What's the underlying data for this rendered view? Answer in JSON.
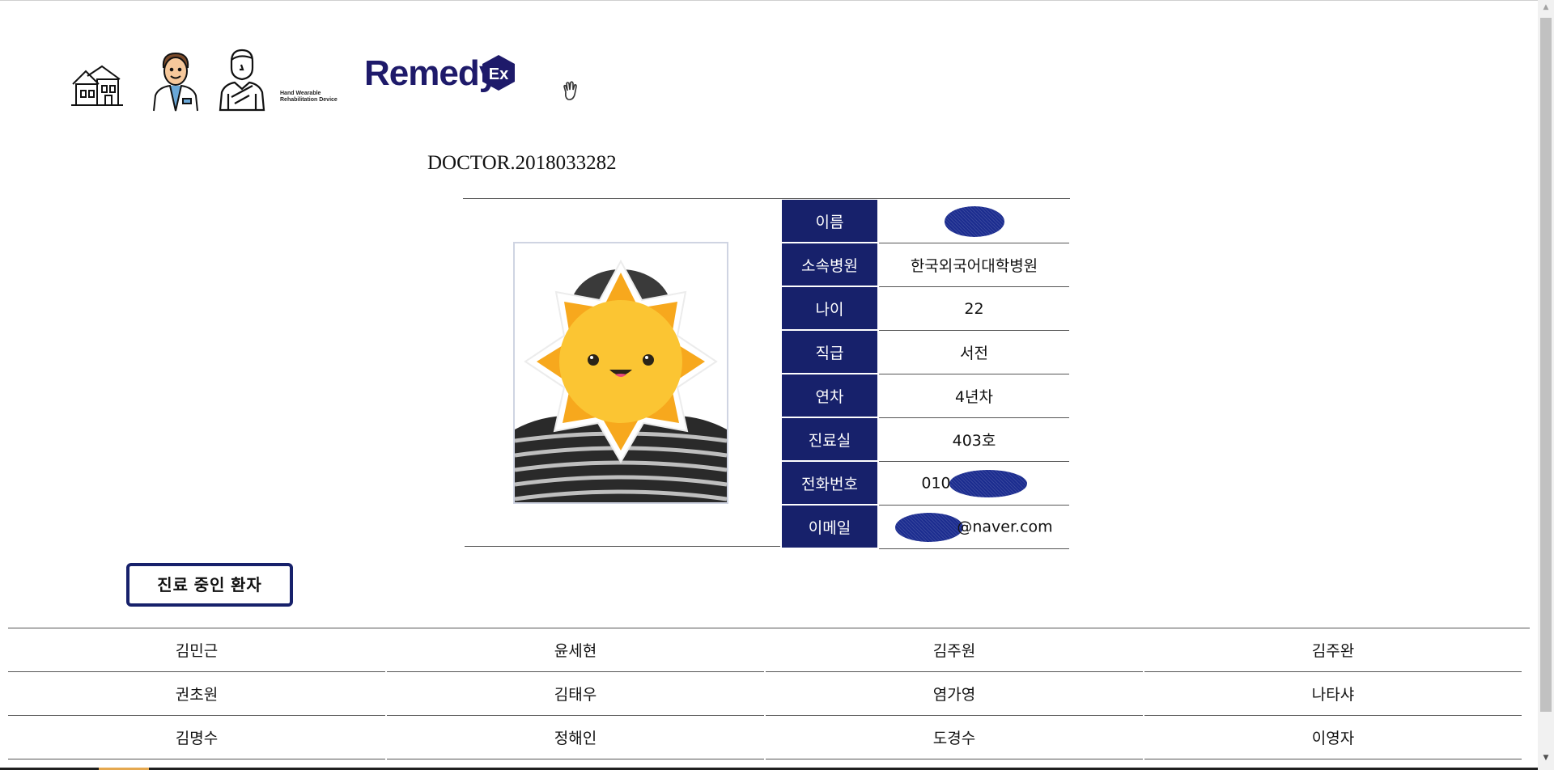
{
  "header": {
    "nav_icons": [
      "home-icon",
      "doctor-icon",
      "patient-icon"
    ],
    "brand": {
      "name": "Remedy",
      "badge": "Ex",
      "tagline_line1": "Hand Wearable",
      "tagline_line2": "Rehabilitation Device"
    },
    "extra_icon": "hand-wave-icon"
  },
  "doctor": {
    "title": "DOCTOR.2018033282",
    "fields": [
      {
        "label": "이름",
        "value": ""
      },
      {
        "label": "소속병원",
        "value": "한국외국어대학병원"
      },
      {
        "label": "나이",
        "value": "22"
      },
      {
        "label": "직급",
        "value": "서전"
      },
      {
        "label": "연차",
        "value": "4년차"
      },
      {
        "label": "진료실",
        "value": "403호"
      },
      {
        "label": "전화번호",
        "value": "010"
      },
      {
        "label": "이메일",
        "value": "@naver.com"
      }
    ]
  },
  "patients": {
    "button_label": "진료 중인 환자",
    "rows": [
      [
        "김민근",
        "윤세현",
        "김주원",
        "김주완"
      ],
      [
        "권초원",
        "김태우",
        "염가영",
        "나타샤"
      ],
      [
        "김명수",
        "정해인",
        "도경수",
        "이영자"
      ]
    ]
  },
  "colors": {
    "navy": "#17216b",
    "brand": "#1e1a6a",
    "sun": "#f7b32b"
  }
}
